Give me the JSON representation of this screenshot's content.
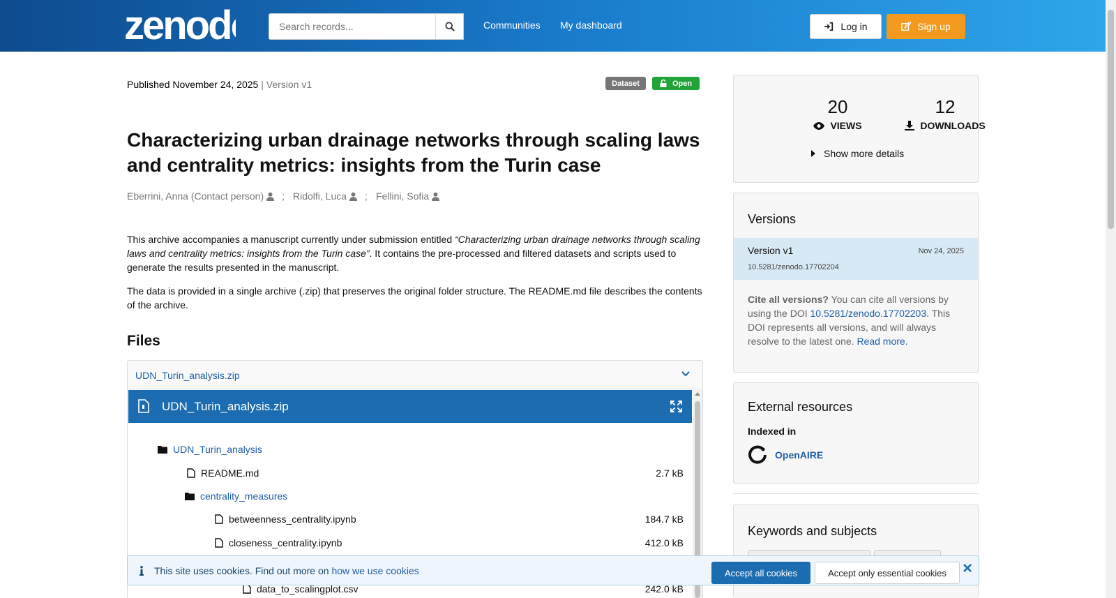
{
  "header": {
    "logo_text": "zenodo",
    "search_placeholder": "Search records...",
    "nav": [
      "Communities",
      "My dashboard"
    ],
    "login_label": "Log in",
    "signup_label": "Sign up"
  },
  "record": {
    "published_label": "Published November 24, 2025",
    "version_label": " | Version v1",
    "badge_type": "Dataset",
    "badge_access": "Open",
    "title": "Characterizing urban drainage networks through scaling laws and centrality metrics: insights from the Turin case",
    "authors": [
      "Eberrini, Anna (Contact person)",
      "Ridolfi, Luca",
      "Fellini, Sofia"
    ],
    "author_sep": ";",
    "desc1_pre": "This archive accompanies a manuscript currently under submission entitled ",
    "desc1_italic": "“Characterizing urban drainage networks through scaling laws and centrality metrics: insights from the Turin case”",
    "desc1_post": ". It contains the pre-processed and filtered datasets and scripts used to generate the results presented in the manuscript.",
    "desc2": "The data is provided in a single archive (.zip) that preserves the original folder structure. The README.md file describes the contents of the archive."
  },
  "files": {
    "heading": "Files",
    "archive_name": "UDN_Turin_analysis.zip",
    "preview_title": "UDN_Turin_analysis.zip",
    "tree": [
      {
        "name": "UDN_Turin_analysis",
        "kind": "folder",
        "size": ""
      },
      {
        "name": "README.md",
        "kind": "file",
        "size": "2.7 kB"
      },
      {
        "name": "centrality_measures",
        "kind": "folder",
        "size": ""
      },
      {
        "name": "betweenness_centrality.ipynb",
        "kind": "file",
        "size": "184.7 kB"
      },
      {
        "name": "closeness_centrality.ipynb",
        "kind": "file",
        "size": "412.0 kB"
      },
      {
        "name": "data_to_scalingplot.csv",
        "kind": "file",
        "size": "242.0 kB"
      }
    ]
  },
  "stats": {
    "views": "20",
    "views_label": "VIEWS",
    "downloads": "12",
    "downloads_label": "DOWNLOADS",
    "more_details": "Show more details"
  },
  "versions": {
    "heading": "Versions",
    "current_label": "Version v1",
    "current_date": "Nov 24, 2025",
    "current_doi": "10.5281/zenodo.17702204",
    "cite_bold": "Cite all versions?",
    "cite_pre": " You can cite all versions by using the DOI ",
    "cite_doi": "10.5281/zenodo.17702203",
    "cite_post": ". This DOI represents all versions, and will always resolve to the latest one. ",
    "read_more": "Read more."
  },
  "external": {
    "heading": "External resources",
    "indexed_label": "Indexed in",
    "indexer": "OpenAIRE"
  },
  "keywords": {
    "heading": "Keywords and subjects"
  },
  "cookie": {
    "text": "This site uses cookies. Find out more on ",
    "link": "how we use cookies",
    "accept_all": "Accept all cookies",
    "accept_essential": "Accept only essential cookies"
  },
  "colors": {
    "header_start": "#0d4b8e",
    "header_end": "#2fa6ea",
    "signup": "#f39a1e",
    "open_badge": "#21a339",
    "preview_head": "#1b6cb0"
  }
}
